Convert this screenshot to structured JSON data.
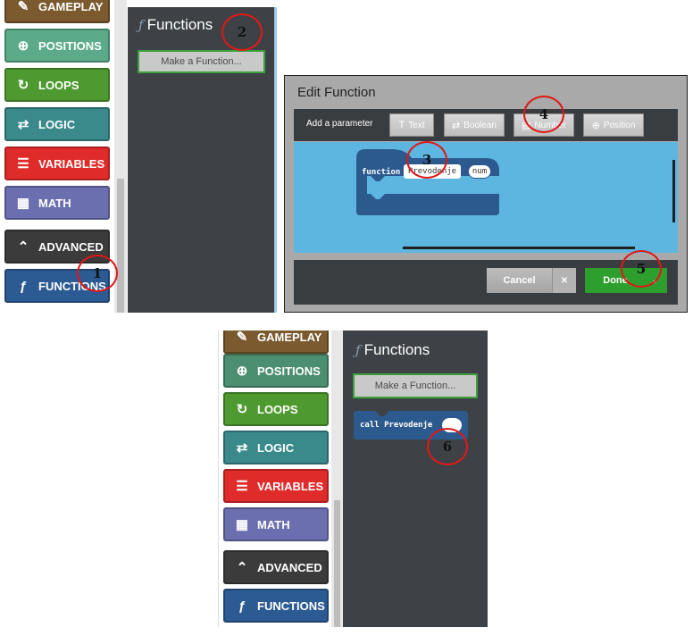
{
  "categories_top": [
    {
      "id": "gameplay",
      "label": "GAMEPLAY",
      "icon": "wrench-icon",
      "glyph": "✎",
      "color": "#7a5a2e"
    },
    {
      "id": "positions",
      "label": "POSITIONS",
      "icon": "crosshair-icon",
      "glyph": "⊕",
      "color": "#5bab8a"
    },
    {
      "id": "loops",
      "label": "LOOPS",
      "icon": "loop-icon",
      "glyph": "↻",
      "color": "#4f9a30"
    },
    {
      "id": "logic",
      "label": "LOGIC",
      "icon": "shuffle-icon",
      "glyph": "⇄",
      "color": "#3a8a8c"
    },
    {
      "id": "variables",
      "label": "VARIABLES",
      "icon": "list-icon",
      "glyph": "☰",
      "color": "#e02b2b"
    },
    {
      "id": "math",
      "label": "MATH",
      "icon": "calculator-icon",
      "glyph": "▦",
      "color": "#6b6fb0"
    },
    {
      "id": "advanced",
      "label": "ADVANCED",
      "icon": "chevron-up-icon",
      "glyph": "⌃",
      "color": "#3b3b3b"
    },
    {
      "id": "functions",
      "label": "FUNCTIONS",
      "icon": "function-icon",
      "glyph": "ƒ",
      "color": "#2c5b93"
    }
  ],
  "categories_bottom": [
    {
      "id": "gameplay",
      "label": "GAMEPLAY",
      "icon": "wrench-icon",
      "glyph": "✎",
      "color": "#7a5a2e"
    },
    {
      "id": "positions",
      "label": "POSITIONS",
      "icon": "crosshair-icon",
      "glyph": "⊕",
      "color": "#4b8e70"
    },
    {
      "id": "loops",
      "label": "LOOPS",
      "icon": "loop-icon",
      "glyph": "↻",
      "color": "#4f9a30"
    },
    {
      "id": "logic",
      "label": "LOGIC",
      "icon": "shuffle-icon",
      "glyph": "⇄",
      "color": "#3a8a8c"
    },
    {
      "id": "variables",
      "label": "VARIABLES",
      "icon": "list-icon",
      "glyph": "☰",
      "color": "#e02b2b"
    },
    {
      "id": "math",
      "label": "MATH",
      "icon": "calculator-icon",
      "glyph": "▦",
      "color": "#6b6fb0"
    },
    {
      "id": "advanced",
      "label": "ADVANCED",
      "icon": "chevron-up-icon",
      "glyph": "⌃",
      "color": "#3b3b3b"
    },
    {
      "id": "functions",
      "label": "FUNCTIONS",
      "icon": "function-icon",
      "glyph": "ƒ",
      "color": "#2c5b93"
    }
  ],
  "flyout": {
    "title": "Functions",
    "icon_glyph": "ƒ",
    "make_button": "Make a Function...",
    "call_block_label": "call Prevodenje"
  },
  "dialog": {
    "title": "Edit Function",
    "add_param_label": "Add a parameter",
    "param_buttons": [
      {
        "label": "Text",
        "icon": "text-icon",
        "glyph": "T"
      },
      {
        "label": "Boolean",
        "icon": "shuffle-icon",
        "glyph": "⇄"
      },
      {
        "label": "Number",
        "icon": "number-icon",
        "glyph": "▤"
      },
      {
        "label": "Position",
        "icon": "crosshair-icon",
        "glyph": "⊕"
      }
    ],
    "block": {
      "keyword": "function",
      "name": "Prevodenje",
      "param": "num"
    },
    "cancel_label": "Cancel",
    "cancel_icon": "✕",
    "done_label": "Done",
    "done_icon": "✓"
  },
  "markers": [
    "1",
    "2",
    "3",
    "4",
    "5",
    "6"
  ]
}
